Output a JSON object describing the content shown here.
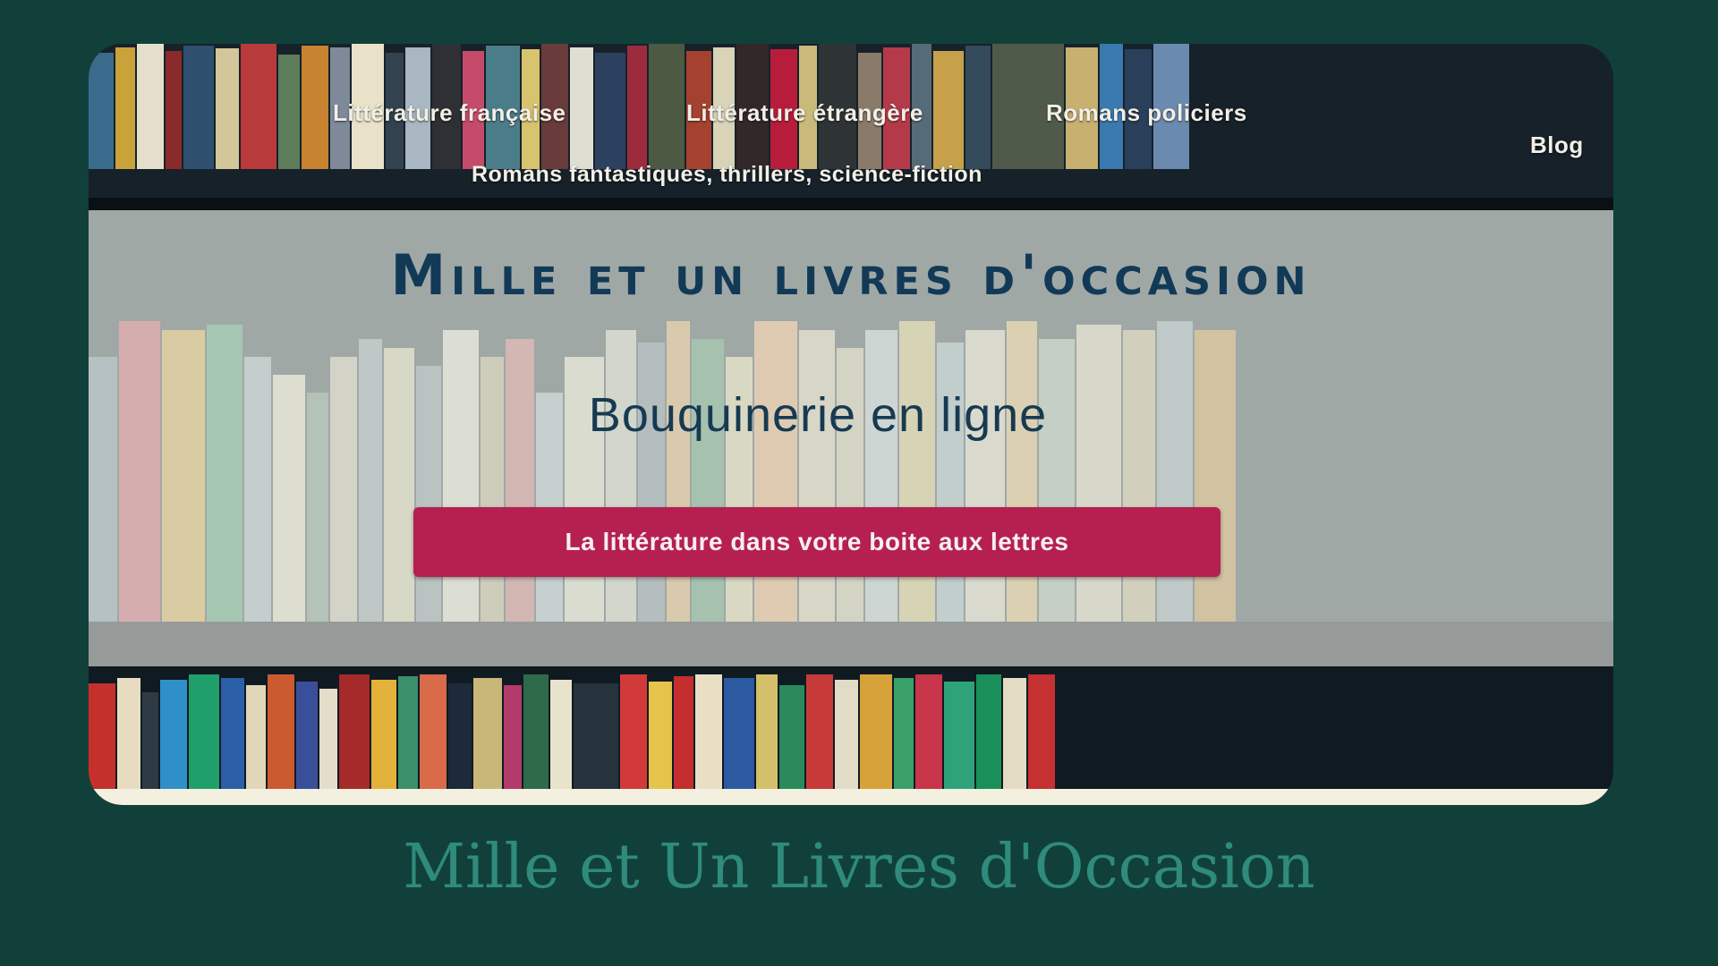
{
  "nav": {
    "items": [
      {
        "label": "Littérature française"
      },
      {
        "label": "Littérature étrangère"
      },
      {
        "label": "Romans policiers"
      },
      {
        "label": "Romans fantastiques, thrillers, science-fiction"
      }
    ],
    "blog_label": "Blog"
  },
  "hero": {
    "title": "Mille et un livres d'occasion",
    "subtitle": "Bouquinerie en ligne",
    "cta_label": "La littérature dans votre boite aux lettres"
  },
  "caption": "Mille et Un Livres d'Occasion",
  "colors": {
    "page_background": "#11403a",
    "accent_button": "#b52051",
    "title_text": "#123a57",
    "caption_text": "#2f8b7c"
  }
}
